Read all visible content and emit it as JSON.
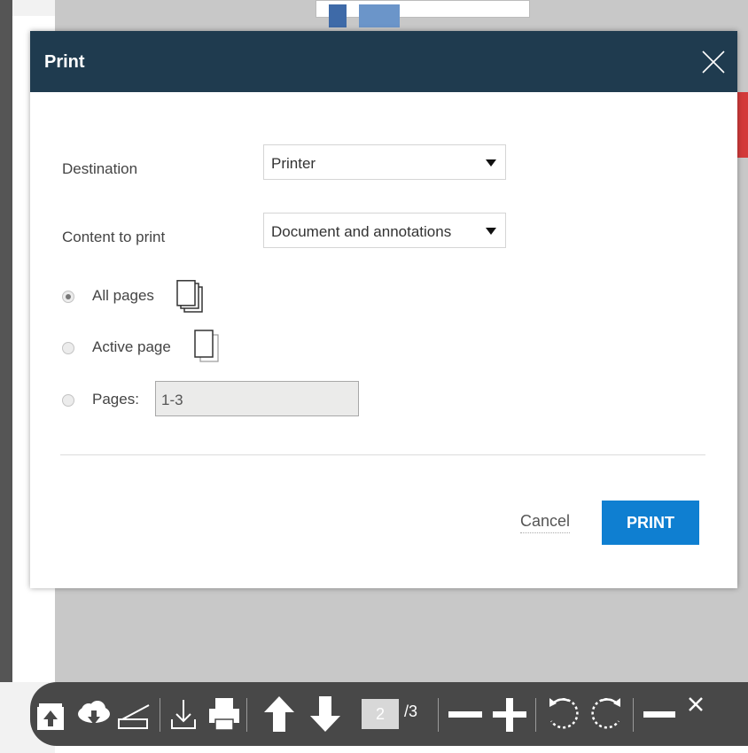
{
  "dialog": {
    "title": "Print",
    "destination_label": "Destination",
    "destination_value": "Printer",
    "content_label": "Content to print",
    "content_value": "Document and annotations",
    "options": {
      "all_pages": "All pages",
      "active_page": "Active page",
      "pages": "Pages:"
    },
    "selected_option": "all_pages",
    "pages_input_value": "1-3",
    "cancel_label": "Cancel",
    "print_label": "PRINT"
  },
  "toolbar": {
    "current_page": "2",
    "total_pages": "/3",
    "icons": [
      "open-icon",
      "cloud-download-icon",
      "scanner-icon",
      "download-icon",
      "printer-icon",
      "arrow-up-icon",
      "arrow-down-icon",
      "zoom-out-icon",
      "zoom-in-icon",
      "rotate-left-icon",
      "rotate-right-icon",
      "minimize-icon",
      "close-icon"
    ]
  },
  "colors": {
    "header": "#1f3b4f",
    "primary_button": "#0f7fd1",
    "toolbar": "#484848"
  }
}
